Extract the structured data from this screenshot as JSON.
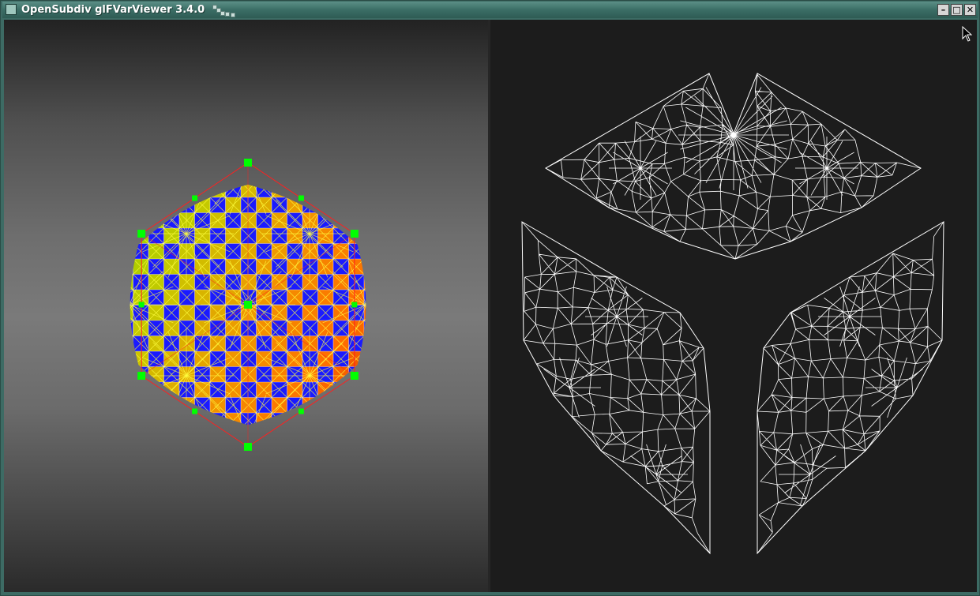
{
  "window": {
    "title": "OpenSubdiv glFVarViewer 3.4.0",
    "icon": "app-window-icon",
    "buttons": [
      {
        "name": "minimize",
        "glyph": "–"
      },
      {
        "name": "maximize",
        "glyph": "□"
      },
      {
        "name": "close",
        "glyph": "✕"
      }
    ]
  },
  "viewport3d": {
    "mesh": "subdivided hexagon",
    "cage_color": "#ff2020",
    "control_point_color": "#00ff00",
    "wire_color": "#ffff40",
    "checker_colors": [
      "#1a1aff",
      "#8cd400",
      "#c8c800",
      "#ff7a00",
      "#e02000"
    ]
  },
  "uv_view": {
    "background": "#1c1c1c",
    "wire_color": "#ffffff",
    "patches": 3
  }
}
